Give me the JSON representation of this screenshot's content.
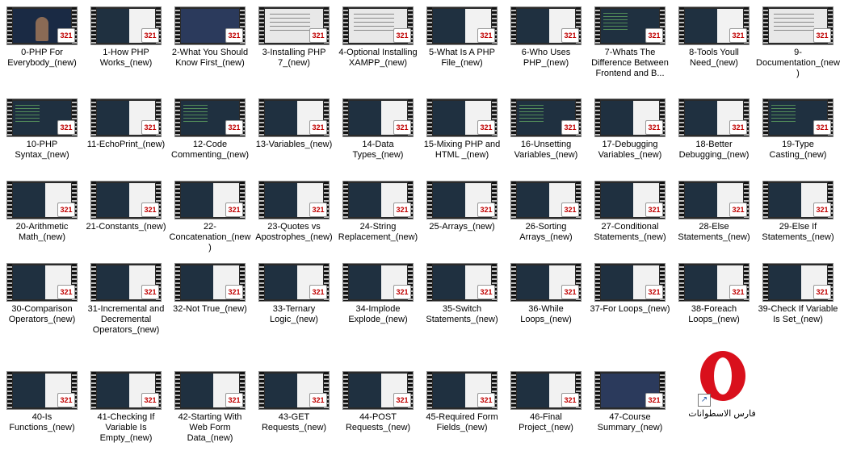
{
  "files": [
    {
      "label": "0-PHP For Everybody_(new)",
      "screen": "video"
    },
    {
      "label": "1-How PHP Works_(new)",
      "screen": "panel"
    },
    {
      "label": "2-What You Should Know First_(new)",
      "screen": "blue"
    },
    {
      "label": "3-Installing PHP 7_(new)",
      "screen": "light"
    },
    {
      "label": "4-Optional Installing XAMPP_(new)",
      "screen": "light"
    },
    {
      "label": "5-What Is A PHP File_(new)",
      "screen": "panel"
    },
    {
      "label": "6-Who Uses PHP_(new)",
      "screen": "panel"
    },
    {
      "label": "7-Whats The Difference Between Frontend and B...",
      "screen": "code"
    },
    {
      "label": "8-Tools Youll Need_(new)",
      "screen": "panel"
    },
    {
      "label": "9-Documentation_(new)",
      "screen": "light"
    },
    {
      "label": "10-PHP Syntax_(new)",
      "screen": "code"
    },
    {
      "label": "11-EchoPrint_(new)",
      "screen": "panel"
    },
    {
      "label": "12-Code Commenting_(new)",
      "screen": "code"
    },
    {
      "label": "13-Variables_(new)",
      "screen": "panel"
    },
    {
      "label": "14-Data Types_(new)",
      "screen": "panel"
    },
    {
      "label": "15-Mixing PHP and HTML _(new)",
      "screen": "panel"
    },
    {
      "label": "16-Unsetting Variables_(new)",
      "screen": "code"
    },
    {
      "label": "17-Debugging Variables_(new)",
      "screen": "panel"
    },
    {
      "label": "18-Better Debugging_(new)",
      "screen": "panel"
    },
    {
      "label": "19-Type Casting_(new)",
      "screen": "code"
    },
    {
      "label": "20-Arithmetic Math_(new)",
      "screen": "panel"
    },
    {
      "label": "21-Constants_(new)",
      "screen": "panel"
    },
    {
      "label": "22-Concatenation_(new)",
      "screen": "panel"
    },
    {
      "label": "23-Quotes vs Apostrophes_(new)",
      "screen": "panel"
    },
    {
      "label": "24-String Replacement_(new)",
      "screen": "panel"
    },
    {
      "label": "25-Arrays_(new)",
      "screen": "panel"
    },
    {
      "label": "26-Sorting Arrays_(new)",
      "screen": "panel"
    },
    {
      "label": "27-Conditional Statements_(new)",
      "screen": "panel"
    },
    {
      "label": "28-Else Statements_(new)",
      "screen": "panel"
    },
    {
      "label": "29-Else If Statements_(new)",
      "screen": "panel"
    },
    {
      "label": "30-Comparison Operators_(new)",
      "screen": "panel"
    },
    {
      "label": "31-Incremental and Decremental Operators_(new)",
      "screen": "panel"
    },
    {
      "label": "32-Not True_(new)",
      "screen": "panel"
    },
    {
      "label": "33-Ternary Logic_(new)",
      "screen": "panel"
    },
    {
      "label": "34-Implode Explode_(new)",
      "screen": "panel"
    },
    {
      "label": "35-Switch Statements_(new)",
      "screen": "panel"
    },
    {
      "label": "36-While Loops_(new)",
      "screen": "panel"
    },
    {
      "label": "37-For Loops_(new)",
      "screen": "panel"
    },
    {
      "label": "38-Foreach Loops_(new)",
      "screen": "panel"
    },
    {
      "label": "39-Check If Variable Is Set_(new)",
      "screen": "panel"
    },
    {
      "label": "40-Is Functions_(new)",
      "screen": "panel"
    },
    {
      "label": "41-Checking If Variable Is Empty_(new)",
      "screen": "panel"
    },
    {
      "label": "42-Starting With Web Form Data_(new)",
      "screen": "panel"
    },
    {
      "label": "43-GET Requests_(new)",
      "screen": "panel"
    },
    {
      "label": "44-POST Requests_(new)",
      "screen": "panel"
    },
    {
      "label": "45-Required Form Fields_(new)",
      "screen": "panel"
    },
    {
      "label": "46-Final Project_(new)",
      "screen": "panel"
    },
    {
      "label": "47-Course Summary_(new)",
      "screen": "blue"
    }
  ],
  "badge_text": "321",
  "shortcut": {
    "label": "فارس الاسطوانات",
    "icon": "opera-icon",
    "arrow_icon": "shortcut-arrow-icon"
  },
  "colors": {
    "opera_red": "#d9101c",
    "badge_red": "#c00000"
  }
}
